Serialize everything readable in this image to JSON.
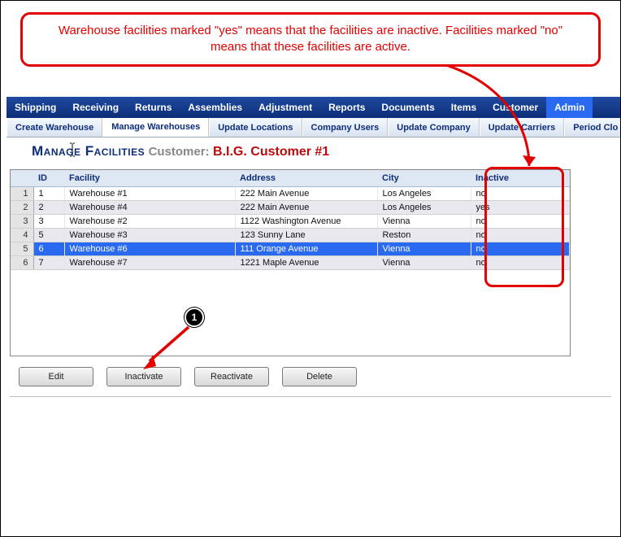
{
  "callout": {
    "text": "Warehouse facilities marked \"yes\" means that the facilities are inactive. Facilities marked \"no\" means that these facilities are active."
  },
  "nav_primary": [
    "Shipping",
    "Receiving",
    "Returns",
    "Assemblies",
    "Adjustment",
    "Reports",
    "Documents",
    "Items",
    "Customer",
    "Admin"
  ],
  "nav_primary_active": 9,
  "nav_secondary": [
    "Create Warehouse",
    "Manage Warehouses",
    "Update Locations",
    "Company Users",
    "Update Company",
    "Update Carriers",
    "Period Clo"
  ],
  "nav_secondary_active": 1,
  "page": {
    "title": "Manage Facilities",
    "sub_label": "Customer:",
    "customer": "B.I.G. Customer #1"
  },
  "columns": [
    "ID",
    "Facility",
    "Address",
    "City",
    "Inactive"
  ],
  "rows": [
    {
      "n": "1",
      "id": "1",
      "facility": "Warehouse #1",
      "address": "222 Main Avenue",
      "city": "Los Angeles",
      "inactive": "no"
    },
    {
      "n": "2",
      "id": "2",
      "facility": "Warehouse #4",
      "address": "222 Main Avenue",
      "city": "Los Angeles",
      "inactive": "yes"
    },
    {
      "n": "3",
      "id": "3",
      "facility": "Warehouse #2",
      "address": "1122 Washington Avenue",
      "city": "Vienna",
      "inactive": "no"
    },
    {
      "n": "4",
      "id": "5",
      "facility": "Warehouse #3",
      "address": "123 Sunny Lane",
      "city": "Reston",
      "inactive": "no"
    },
    {
      "n": "5",
      "id": "6",
      "facility": "Warehouse #6",
      "address": "111 Orange Avenue",
      "city": "Vienna",
      "inactive": "no"
    },
    {
      "n": "6",
      "id": "7",
      "facility": "Warehouse #7",
      "address": "1221 Maple Avenue",
      "city": "Vienna",
      "inactive": "no"
    }
  ],
  "selected_row": 4,
  "buttons": {
    "edit": "Edit",
    "inactivate": "Inactivate",
    "reactivate": "Reactivate",
    "delete": "Delete"
  },
  "step_marker": "1"
}
